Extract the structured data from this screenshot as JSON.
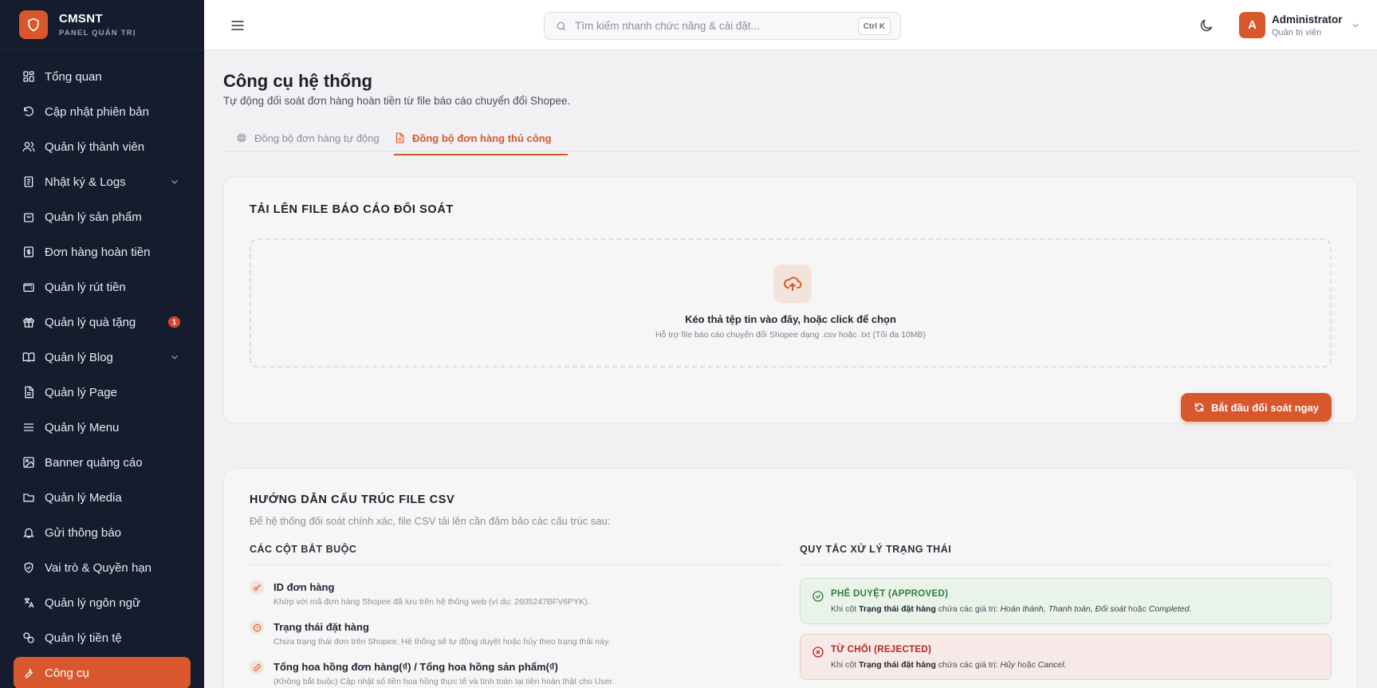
{
  "brand": {
    "name": "CMSNT",
    "subtitle": "PANEL QUẢN TRỊ"
  },
  "sidebar": {
    "items": [
      {
        "label": "Tổng quan",
        "icon": "dashboard-icon"
      },
      {
        "label": "Cập nhật phiên bản",
        "icon": "update-icon"
      },
      {
        "label": "Quản lý thành viên",
        "icon": "users-icon"
      },
      {
        "label": "Nhật ký & Logs",
        "icon": "logs-icon",
        "expandable": true
      },
      {
        "label": "Quản lý sản phẩm",
        "icon": "shopping-bag-icon"
      },
      {
        "label": "Đơn hàng hoàn tiền",
        "icon": "receipt-dollar-icon"
      },
      {
        "label": "Quản lý rút tiền",
        "icon": "wallet-icon"
      },
      {
        "label": "Quản lý quà tặng",
        "icon": "gift-icon",
        "badge": "1"
      },
      {
        "label": "Quản lý Blog",
        "icon": "book-icon",
        "expandable": true
      },
      {
        "label": "Quản lý Page",
        "icon": "file-icon"
      },
      {
        "label": "Quản lý Menu",
        "icon": "menu-icon"
      },
      {
        "label": "Banner quảng cáo",
        "icon": "image-icon"
      },
      {
        "label": "Quản lý Media",
        "icon": "folder-icon"
      },
      {
        "label": "Gửi thông báo",
        "icon": "bell-icon"
      },
      {
        "label": "Vai trò & Quyền hạn",
        "icon": "shield-check-icon"
      },
      {
        "label": "Quản lý ngôn ngữ",
        "icon": "translate-icon"
      },
      {
        "label": "Quản lý tiền tệ",
        "icon": "currency-icon"
      },
      {
        "label": "Công cụ",
        "icon": "wrench-icon",
        "active": true
      }
    ]
  },
  "header": {
    "search_placeholder": "Tìm kiếm nhanh chức năng & cài đặt...",
    "search_shortcut": "Ctrl K",
    "user": {
      "initial": "A",
      "name": "Administrator",
      "role": "Quản trị viên"
    }
  },
  "page": {
    "title": "Công cụ hệ thống",
    "description": "Tự động đối soát đơn hàng hoàn tiền từ file báo cáo chuyển đổi Shopee.",
    "tabs": [
      {
        "label": "Đồng bộ đơn hàng tự động",
        "active": false
      },
      {
        "label": "Đồng bộ đơn hàng thủ công",
        "active": true
      }
    ]
  },
  "upload": {
    "title": "TẢI LÊN FILE BÁO CÁO ĐỐI SOÁT",
    "drop_title": "Kéo thả tệp tin vào đây, hoặc click để chọn",
    "drop_hint": "Hỗ trợ file báo cáo chuyển đổi Shopee dạng .csv hoặc .txt (Tối đa 10MB)",
    "start_button": "Bắt đầu đối soát ngay"
  },
  "guide": {
    "title": "HƯỚNG DẪN CẤU TRÚC FILE CSV",
    "description": "Để hệ thống đối soát chính xác, file CSV tải lên cần đảm bảo các cấu trúc sau:",
    "required_heading": "CÁC CỘT BẮT BUỘC",
    "rules_heading": "QUY TẮC XỬ LÝ TRẠNG THÁI",
    "columns": [
      {
        "title": "ID đơn hàng",
        "desc": "Khớp với mã đơn hàng Shopee đã lưu trên hệ thống web (ví dụ: 2605247BFV6PYK)."
      },
      {
        "title": "Trạng thái đặt hàng",
        "desc": "Chứa trạng thái đơn trên Shopee. Hệ thống sẽ tự động duyệt hoặc hủy theo trạng thái này."
      },
      {
        "title": "Tổng hoa hồng đơn hàng(₫) / Tổng hoa hồng sản phẩm(₫)",
        "desc": "(Không bắt buộc) Cập nhật số tiền hoa hồng thực tế và tính toán lại tiền hoàn thật cho User."
      }
    ],
    "rules": {
      "approved": {
        "title": "PHÊ DUYỆT (APPROVED)",
        "prefix": "Khi cột",
        "column": "Trạng thái đặt hàng",
        "middle": "chứa các giá trị:",
        "values": "Hoàn thành, Thanh toán, Đối soát",
        "joiner": "hoặc",
        "last": "Completed."
      },
      "rejected": {
        "title": "TỪ CHỐI (REJECTED)",
        "prefix": "Khi cột",
        "column": "Trạng thái đặt hàng",
        "middle": "chứa các giá trị:",
        "values": "Hủy",
        "joiner": "hoặc",
        "last": "Cancel."
      }
    }
  },
  "colors": {
    "accent": "#d9572c",
    "sidebar_bg": "#141c2e",
    "success": "#2e7d3a",
    "danger": "#b3261e"
  }
}
